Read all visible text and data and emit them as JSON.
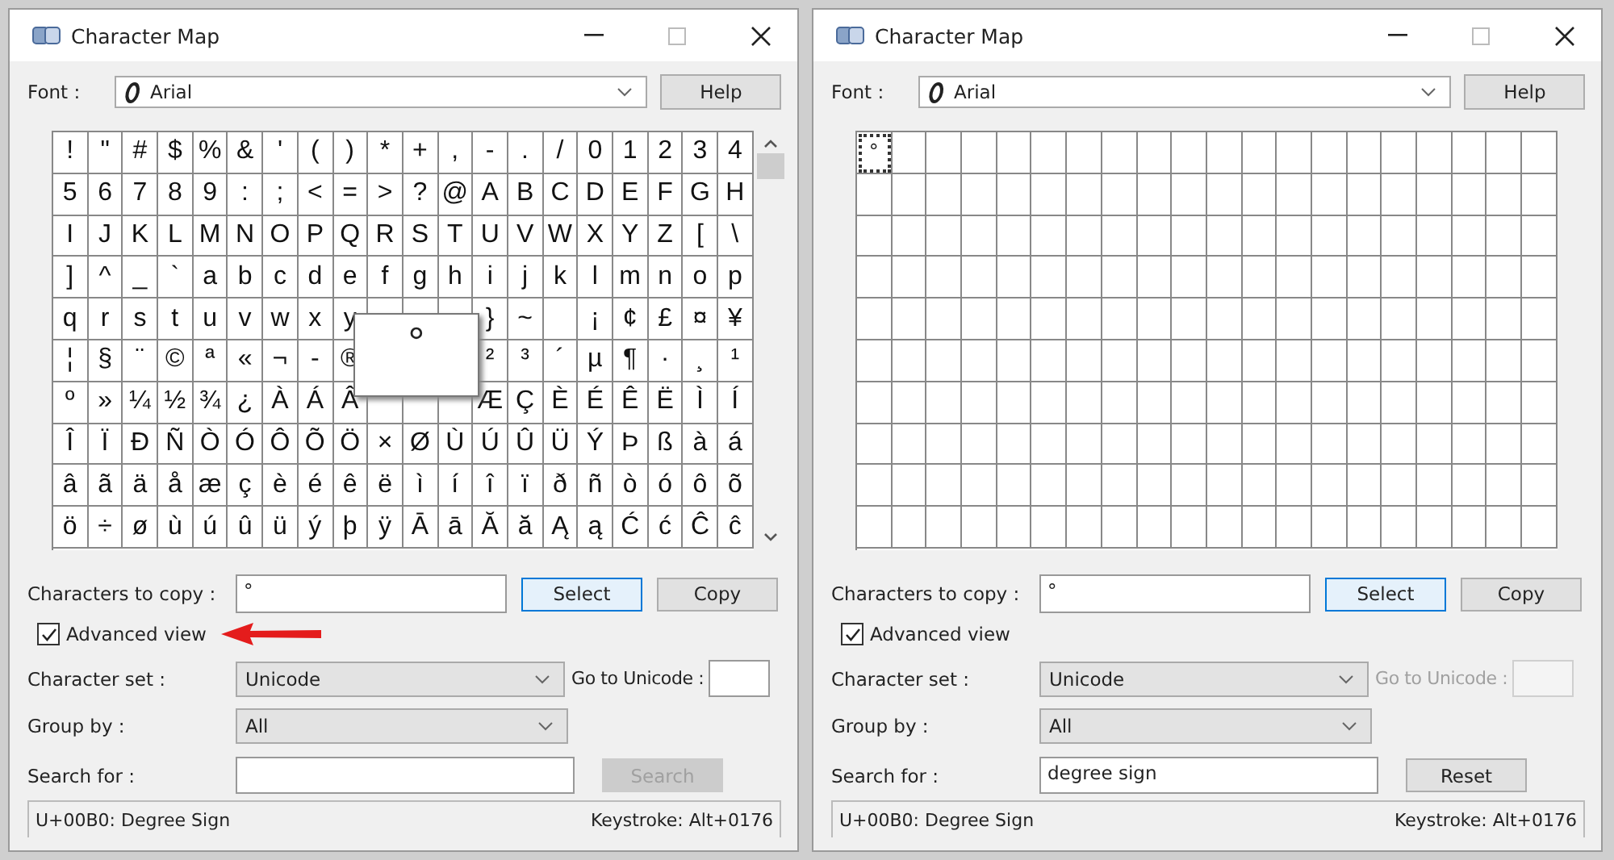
{
  "windows": [
    {
      "title": "Character Map",
      "font_label": "Font :",
      "font_value": "Arial",
      "help": "Help",
      "scrollbar": true,
      "magnified": "°",
      "grid": {
        "rows": [
          [
            "!",
            "\"",
            "#",
            "$",
            "%",
            "&",
            "'",
            "(",
            ")",
            "*",
            "+",
            ",",
            "-",
            ".",
            "/",
            "0",
            "1",
            "2",
            "3",
            "4"
          ],
          [
            "5",
            "6",
            "7",
            "8",
            "9",
            ":",
            ";",
            "<",
            "=",
            ">",
            "?",
            "@",
            "A",
            "B",
            "C",
            "D",
            "E",
            "F",
            "G",
            "H"
          ],
          [
            "I",
            "J",
            "K",
            "L",
            "M",
            "N",
            "O",
            "P",
            "Q",
            "R",
            "S",
            "T",
            "U",
            "V",
            "W",
            "X",
            "Y",
            "Z",
            "[",
            "\\"
          ],
          [
            "]",
            "^",
            "_",
            "`",
            "a",
            "b",
            "c",
            "d",
            "e",
            "f",
            "g",
            "h",
            "i",
            "j",
            "k",
            "l",
            "m",
            "n",
            "o",
            "p"
          ],
          [
            "q",
            "r",
            "s",
            "t",
            "u",
            "v",
            "w",
            "x",
            "y",
            null,
            null,
            null,
            "}",
            "~",
            null,
            "¡",
            "¢",
            "£",
            "¤",
            "¥"
          ],
          [
            "¦",
            "§",
            "¨",
            "©",
            "ª",
            "«",
            "¬",
            "-",
            "®",
            null,
            null,
            null,
            "²",
            "³",
            "´",
            "µ",
            "¶",
            "·",
            "¸",
            "¹"
          ],
          [
            "º",
            "»",
            "¼",
            "½",
            "¾",
            "¿",
            "À",
            "Á",
            "Â",
            null,
            null,
            null,
            "Æ",
            "Ç",
            "È",
            "É",
            "Ê",
            "Ë",
            "Ì",
            "Í"
          ],
          [
            "Î",
            "Ï",
            "Ð",
            "Ñ",
            "Ò",
            "Ó",
            "Ô",
            "Õ",
            "Ö",
            "×",
            "Ø",
            "Ù",
            "Ú",
            "Û",
            "Ü",
            "Ý",
            "Þ",
            "ß",
            "à",
            "á"
          ],
          [
            "â",
            "ã",
            "ä",
            "å",
            "æ",
            "ç",
            "è",
            "é",
            "ê",
            "ë",
            "ì",
            "í",
            "î",
            "ï",
            "ð",
            "ñ",
            "ò",
            "ó",
            "ô",
            "õ"
          ],
          [
            "ö",
            "÷",
            "ø",
            "ù",
            "ú",
            "û",
            "ü",
            "ý",
            "þ",
            "ÿ",
            "Ā",
            "ā",
            "Ă",
            "ă",
            "Ą",
            "ą",
            "Ć",
            "ć",
            "Ĉ",
            "ĉ"
          ]
        ]
      },
      "copy_label": "Characters to copy :",
      "copy_value": "°",
      "select": "Select",
      "copy": "Copy",
      "advanced": {
        "label": "Advanced view",
        "checked": true
      },
      "annotation_arrow": true,
      "charset": {
        "label": "Character set :",
        "value": "Unicode"
      },
      "goto": {
        "label": "Go to Unicode :",
        "disabled": false
      },
      "group": {
        "label": "Group by :",
        "value": "All"
      },
      "search": {
        "label": "Search for :",
        "action": {
          "label": "Search",
          "disabled": true
        }
      },
      "status": {
        "left": "U+00B0: Degree Sign",
        "right": "Keystroke: Alt+0176"
      }
    },
    {
      "title": "Character Map",
      "font_label": "Font :",
      "font_value": "Arial",
      "help": "Help",
      "scrollbar": false,
      "grid": {
        "cells": [
          {
            "char": "°",
            "selected": true
          }
        ]
      },
      "copy_label": "Characters to copy :",
      "copy_value": "°",
      "select": "Select",
      "copy": "Copy",
      "advanced": {
        "label": "Advanced view",
        "checked": true
      },
      "annotation_arrow": false,
      "charset": {
        "label": "Character set :",
        "value": "Unicode"
      },
      "goto": {
        "label": "Go to Unicode :",
        "disabled": true
      },
      "group": {
        "label": "Group by :",
        "value": "All"
      },
      "search": {
        "label": "Search for :",
        "value": "degree sign",
        "action": {
          "label": "Reset",
          "disabled": false
        }
      },
      "status": {
        "left": "U+00B0: Degree Sign",
        "right": "Keystroke: Alt+0176"
      }
    }
  ]
}
